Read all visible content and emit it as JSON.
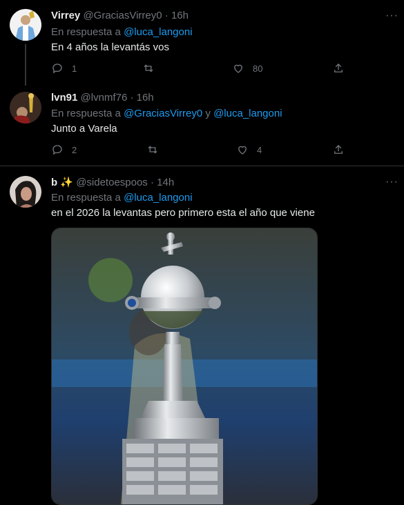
{
  "tweets": [
    {
      "name": "Virrey",
      "handle": "@GraciasVirrey0",
      "time": "16h",
      "reply_prefix": "En respuesta a",
      "reply_users": [
        "@luca_langoni"
      ],
      "text": "En 4 años la levantás vos",
      "replies": "1",
      "retweets": "",
      "likes": "80"
    },
    {
      "name": "lvn91",
      "handle": "@lvnmf76",
      "time": "16h",
      "reply_prefix": "En respuesta a",
      "reply_users": [
        "@GraciasVirrey0",
        "@luca_langoni"
      ],
      "reply_joiner": "y",
      "text": "Junto a Varela",
      "replies": "2",
      "retweets": "",
      "likes": "4"
    },
    {
      "name": "b ✨",
      "handle": "@sidetoespoos",
      "time": "14h",
      "reply_prefix": "En respuesta a",
      "reply_users": [
        "@luca_langoni"
      ],
      "text": "en el 2026 la levantas pero primero esta el año que viene"
    }
  ],
  "separator": "·",
  "more_label": "···",
  "colors": {
    "accent": "#1d9bf0",
    "muted": "#71767b",
    "background": "#000000"
  }
}
